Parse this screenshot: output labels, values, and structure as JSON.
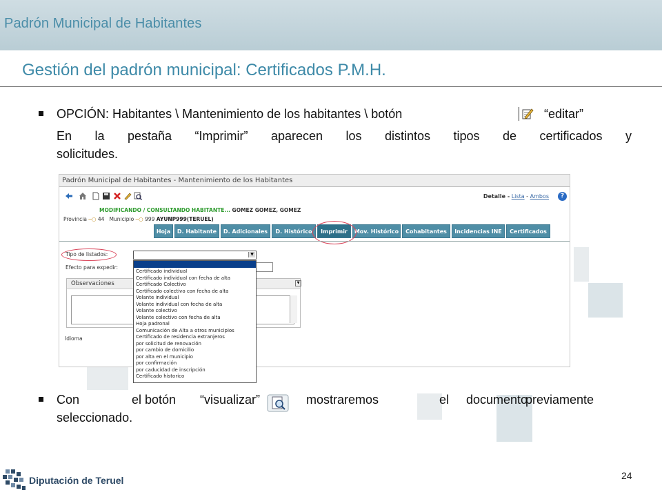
{
  "header": {
    "app_title": "Padrón Municipal de Habitantes"
  },
  "slide": {
    "title": "Gestión del padrón municipal: Certificados P.M.H.",
    "page_number": "24"
  },
  "bullet1": {
    "option_text": "OPCIÓN: Habitantes \\ Mantenimiento de los habitantes \\ botón",
    "edit_label": "“editar”",
    "para_line1": "En la pestaña “Imprimir” aparecen los distintos tipos de certificados y",
    "para_line2": "solicitudes."
  },
  "bullet2": {
    "w1": "Con",
    "w2": "el botón",
    "w3": "“visualizar”",
    "w4": "mostraremos",
    "w5": "el",
    "w6": "documento",
    "w7": "previamente",
    "line2": "seleccionado."
  },
  "screenshot": {
    "window_title": "Padrón Municipal de Habitantes - Mantenimiento de los Habitantes",
    "detail_label": "Detalle -",
    "link_lista": "Lista",
    "link_sep": "-",
    "link_ambos": "Ambos",
    "help_label": "?",
    "mod_status": "MODIFICANDO / CONSULTANDO HABITANTE...",
    "person_name": "GOMEZ GOMEZ, GOMEZ",
    "provincia_label": "Provincia",
    "provincia_value": "44",
    "municipio_label": "Municipio",
    "municipio_value": "999",
    "municipio_name": "AYUNP999(TERUEL)",
    "tabs": [
      "Hoja",
      "D. Habitante",
      "D. Adicionales",
      "D. Histórico",
      "Imprimir",
      "Mov. Histórico",
      "Cohabitantes",
      "Incidencias INE",
      "Certificados"
    ],
    "active_tab": "Imprimir",
    "tipo_label": "Tipo de listados:",
    "efecto_label": "Efecto para expedir:",
    "observaciones_label": "Observaciones",
    "idioma_label": "Idioma",
    "dropdown_items": [
      "Certificado individual",
      "Certificado individual con fecha de alta",
      "Certificado Colectivo",
      "Certificado colectivo con fecha de alta",
      "Volante individual",
      "Volante individual con fecha de alta",
      "Volante colectivo",
      "Volante colectivo con fecha de alta",
      "Hoja padronal",
      "Comunicación de Alta a otros municipios",
      "Certificado de residencia extranjeros",
      "por solicitud de renovación",
      "por cambio de domicilio",
      "por alta en el municipio",
      "por confirmación",
      "por caducidad de inscripción",
      "Certificado historico"
    ]
  },
  "footer": {
    "logo_text": "Diputación de Teruel"
  },
  "colors": {
    "title_blue": "#3e8aa8",
    "tab_teal": "#4f8ea6",
    "highlight_red": "#d9455a",
    "status_green": "#2c9a2c"
  }
}
